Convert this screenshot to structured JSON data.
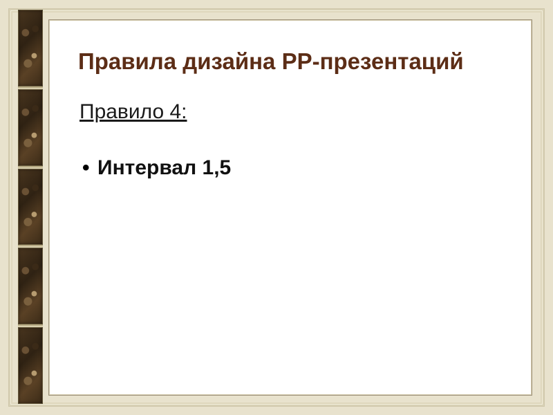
{
  "slide": {
    "title": "Правила дизайна РР-презентаций",
    "subtitle": "Правило 4:",
    "bullets": [
      "Интервал 1,5"
    ]
  },
  "theme": {
    "title_color": "#5c2d16",
    "background": "#e8e2cd",
    "slide_bg": "#ffffff"
  }
}
